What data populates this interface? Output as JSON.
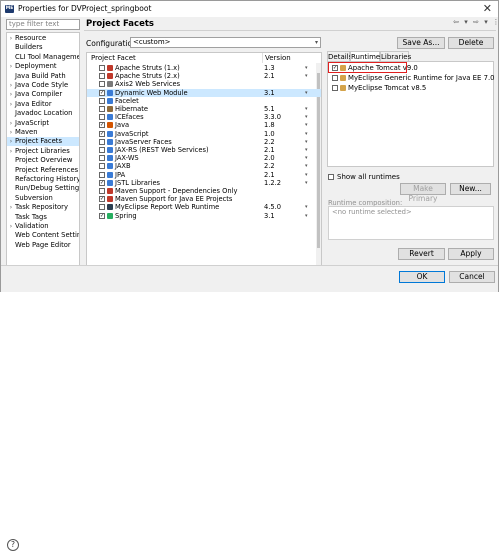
{
  "window": {
    "title": "Properties for DVProject_springboot",
    "app_icon": "eclipse",
    "close_glyph": "✕"
  },
  "sidebar": {
    "filter_placeholder": "type filter text",
    "items": [
      {
        "label": "Resource",
        "arrow": "›"
      },
      {
        "label": "Builders",
        "arrow": ""
      },
      {
        "label": "CLI Tool Manageme",
        "arrow": ""
      },
      {
        "label": "Deployment",
        "arrow": "›"
      },
      {
        "label": "Java Build Path",
        "arrow": ""
      },
      {
        "label": "Java Code Style",
        "arrow": "›"
      },
      {
        "label": "Java Compiler",
        "arrow": "›"
      },
      {
        "label": "Java Editor",
        "arrow": "›"
      },
      {
        "label": "Javadoc Location",
        "arrow": ""
      },
      {
        "label": "JavaScript",
        "arrow": "›"
      },
      {
        "label": "Maven",
        "arrow": "›"
      },
      {
        "label": "Project Facets",
        "arrow": "›"
      },
      {
        "label": "Project Libraries",
        "arrow": "›"
      },
      {
        "label": "Project Overview",
        "arrow": ""
      },
      {
        "label": "Project References",
        "arrow": ""
      },
      {
        "label": "Refactoring History",
        "arrow": ""
      },
      {
        "label": "Run/Debug Settings",
        "arrow": ""
      },
      {
        "label": "Subversion",
        "arrow": ""
      },
      {
        "label": "Task Repository",
        "arrow": "›"
      },
      {
        "label": "Task Tags",
        "arrow": ""
      },
      {
        "label": "Validation",
        "arrow": "›"
      },
      {
        "label": "Web Content Settin",
        "arrow": ""
      },
      {
        "label": "Web Page Editor",
        "arrow": ""
      }
    ],
    "scroll_left": "‹",
    "scroll_right": "›"
  },
  "main": {
    "title": "Project Facets",
    "nav": {
      "back": "⇦",
      "back_dd": "▾",
      "forward": "⇨",
      "forward_dd": "▾",
      "menu": "⋮"
    },
    "configuration_label": "Configuration:",
    "configuration_value": "<custom>",
    "save_as_label": "Save As...",
    "delete_label": "Delete",
    "columns": {
      "facet": "Project Facet",
      "version": "Version"
    },
    "facets": [
      {
        "name": "Apache Struts (1.x)",
        "version": "1.3",
        "checked": false,
        "icon_color": "#c0392b",
        "indent": 0
      },
      {
        "name": "Apache Struts (2.x)",
        "version": "2.1",
        "checked": false,
        "icon_color": "#c0392b",
        "indent": 0
      },
      {
        "name": "Axis2 Web Services",
        "version": "",
        "checked": false,
        "icon_color": "#7a7a7a",
        "indent": 0
      },
      {
        "name": "Dynamic Web Module",
        "version": "3.1",
        "checked": true,
        "icon_color": "#3a7bd5",
        "indent": 0
      },
      {
        "name": "Facelet",
        "version": "",
        "checked": false,
        "icon_color": "#3a7bd5",
        "indent": 0
      },
      {
        "name": "Hibernate",
        "version": "5.1",
        "checked": false,
        "icon_color": "#8e6b3b",
        "indent": 0
      },
      {
        "name": "ICEfaces",
        "version": "3.3.0",
        "checked": false,
        "icon_color": "#3a7bd5",
        "indent": 0
      },
      {
        "name": "Java",
        "version": "1.8",
        "checked": true,
        "icon_color": "#d35400",
        "indent": 0
      },
      {
        "name": "JavaScript",
        "version": "1.0",
        "checked": true,
        "icon_color": "#3a7bd5",
        "indent": 0
      },
      {
        "name": "JavaServer Faces",
        "version": "2.2",
        "checked": false,
        "icon_color": "#3a7bd5",
        "indent": 0
      },
      {
        "name": "JAX-RS (REST Web Services)",
        "version": "2.1",
        "checked": false,
        "icon_color": "#3a7bd5",
        "indent": 0
      },
      {
        "name": "JAX-WS",
        "version": "2.0",
        "checked": false,
        "icon_color": "#3a7bd5",
        "indent": 0
      },
      {
        "name": "JAXB",
        "version": "2.2",
        "checked": false,
        "icon_color": "#3a7bd5",
        "indent": 0
      },
      {
        "name": "JPA",
        "version": "2.1",
        "checked": false,
        "icon_color": "#3a7bd5",
        "indent": 0
      },
      {
        "name": "JSTL Libraries",
        "version": "1.2.2",
        "checked": true,
        "icon_color": "#3a7bd5",
        "indent": 0
      },
      {
        "name": "Maven Support - Dependencies Only",
        "version": "",
        "checked": false,
        "icon_color": "#c0392b",
        "indent": 0
      },
      {
        "name": "Maven Support for Java EE Projects",
        "version": "",
        "checked": true,
        "icon_color": "#c0392b",
        "indent": 0
      },
      {
        "name": "MyEclipse Report Web Runtime",
        "version": "4.5.0",
        "checked": false,
        "icon_color": "#2c3e50",
        "indent": 0
      },
      {
        "name": "Spring",
        "version": "3.1",
        "checked": true,
        "icon_color": "#27ae60",
        "indent": 0
      }
    ],
    "version_dropdown_glyph": "▾",
    "tabs": [
      "Details",
      "Runtimes",
      "Libraries"
    ],
    "runtimes": [
      {
        "name": "Apache Tomcat v9.0",
        "checked": true
      },
      {
        "name": "MyEclipse Generic Runtime for Java EE 7.0",
        "checked": false
      },
      {
        "name": "MyEclipse Tomcat v8.5",
        "checked": false
      }
    ],
    "show_all_runtimes_label": "Show all runtimes",
    "make_primary_label": "Make Primary",
    "new_label": "New...",
    "runtime_composition_label": "Runtime composition:",
    "runtime_composition_value": "<no runtime selected>",
    "revert_label": "Revert",
    "apply_label": "Apply"
  },
  "footer": {
    "help_glyph": "?",
    "ok_label": "OK",
    "cancel_label": "Cancel"
  }
}
